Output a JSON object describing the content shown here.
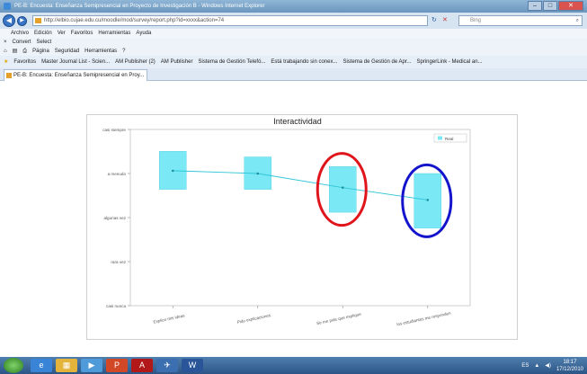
{
  "window": {
    "title": "PE-B: Encuesta: Enseñanza Semipresencial en Proyecto de Investigación B - Windows Internet Explorer"
  },
  "address": {
    "url": "http://elbio.cujae.edu.cu/moodle/mod/survey/report.php?id=xxxx&action=74",
    "search_placeholder": "Bing"
  },
  "menu": [
    "Archivo",
    "Edición",
    "Ver",
    "Favoritos",
    "Herramientas",
    "Ayuda"
  ],
  "convert_bar": [
    "Convert",
    "Select"
  ],
  "command_bar": [
    "Página",
    "Seguridad",
    "Herramientas"
  ],
  "favorites": {
    "label": "Favoritos",
    "items": [
      "Master Journal List - Scien...",
      "AM Publisher (2)",
      "AM Publisher",
      "Sistema de Gestión Telefó...",
      "Está trabajando sin conex...",
      "Sistema de Gestión de Apr...",
      "SpringerLink - Medical an..."
    ]
  },
  "tab": {
    "label": "PE-B: Encuesta: Enseñanza Semipresencial en Proy..."
  },
  "chart_data": {
    "type": "box",
    "title": "Interactividad",
    "categories": [
      "Explico mis ideas",
      "Pido explicaciones",
      "Se me pide que explique",
      "los estudiantes me responden"
    ],
    "y_ticks": [
      "casi siempre",
      "a menudo",
      "algunas vez",
      "rara vez",
      "casi nunca"
    ],
    "series": [
      {
        "name": "Real",
        "values": [
          3.83,
          3.75,
          3.35,
          3.0
        ],
        "box_low": [
          3.3,
          3.3,
          2.65,
          2.2
        ],
        "box_high": [
          4.38,
          4.22,
          3.95,
          3.75
        ]
      }
    ],
    "ylim": [
      0,
      5
    ],
    "colors": {
      "box": "#7be9f5",
      "line": "#2ec4d6",
      "highlight_red": "#e0141b",
      "highlight_blue": "#1414cc"
    },
    "highlighted_categories": [
      2,
      3
    ]
  },
  "taskbar": {
    "apps": [
      "ie-icon",
      "explorer-icon",
      "media-icon",
      "powerpoint-icon",
      "acrobat-icon",
      "bird-icon",
      "word-icon"
    ],
    "language": "ES",
    "time": "18:17",
    "date": "17/12/2010"
  }
}
